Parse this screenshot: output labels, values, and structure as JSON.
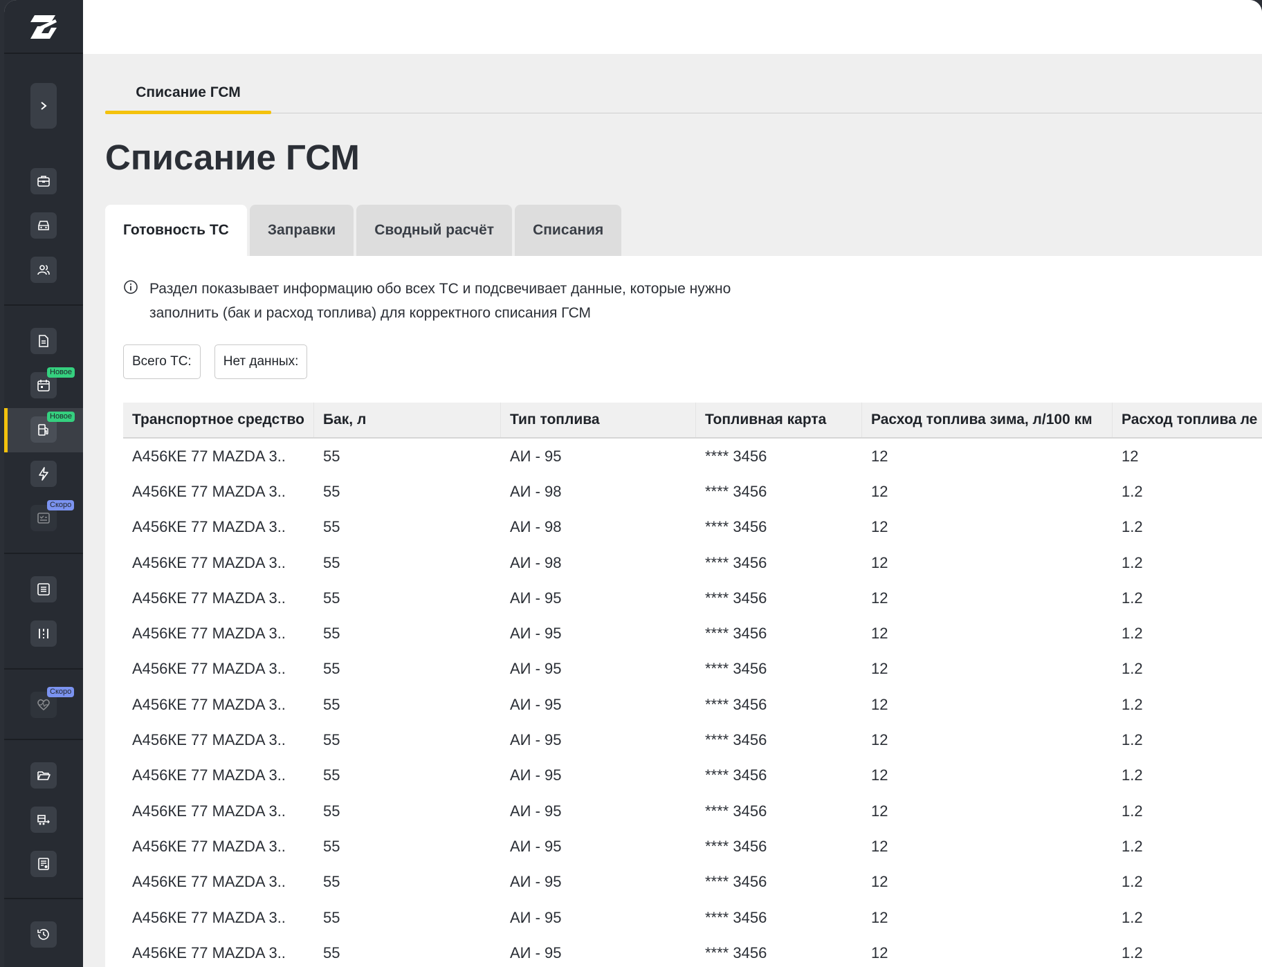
{
  "sidebar": {
    "badges": {
      "new_1": "Новое",
      "new_2": "Новое",
      "soon_1": "Скоро",
      "soon_2": "Скоро"
    }
  },
  "breadcrumb": {
    "tab_label": "Списание ГСМ"
  },
  "page": {
    "title": "Списание ГСМ"
  },
  "tabs": [
    {
      "label": "Готовность ТС",
      "active": true
    },
    {
      "label": "Заправки",
      "active": false
    },
    {
      "label": "Сводный расчёт",
      "active": false
    },
    {
      "label": "Списания",
      "active": false
    }
  ],
  "info": {
    "line1": "Раздел показывает информацию обо всех ТС и подсвечивает данные, которые нужно",
    "line2": "заполнить (бак и расход топлива) для корректного списания ГСМ"
  },
  "chips": {
    "total": "Всего ТС:",
    "no_data": "Нет данных:"
  },
  "colors": {
    "accent": "#f4c20d",
    "sidebar_bg": "#272b32",
    "badge_new": "#35d07f",
    "badge_soon": "#7b93f0"
  },
  "table": {
    "headers": [
      "Транспортное средство",
      "Бак, л",
      "Тип топлива",
      "Топливная карта",
      "Расход топлива зима, л/100 км",
      "Расход топлива ле"
    ],
    "rows": [
      [
        "А456КЕ 77 MAZDA 3..",
        "55",
        "АИ - 95",
        "**** 3456",
        "12",
        "12"
      ],
      [
        "А456КЕ 77 MAZDA 3..",
        "55",
        "АИ - 98",
        "**** 3456",
        "12",
        "1.2"
      ],
      [
        "А456КЕ 77 MAZDA 3..",
        "55",
        "АИ - 98",
        "**** 3456",
        "12",
        "1.2"
      ],
      [
        "А456КЕ 77 MAZDA 3..",
        "55",
        "АИ - 98",
        "**** 3456",
        "12",
        "1.2"
      ],
      [
        "А456КЕ 77 MAZDA 3..",
        "55",
        "АИ - 95",
        "**** 3456",
        "12",
        "1.2"
      ],
      [
        "А456КЕ 77 MAZDA 3..",
        "55",
        "АИ - 95",
        "**** 3456",
        "12",
        "1.2"
      ],
      [
        "А456КЕ 77 MAZDA 3..",
        "55",
        "АИ - 95",
        "**** 3456",
        "12",
        "1.2"
      ],
      [
        "А456КЕ 77 MAZDA 3..",
        "55",
        "АИ - 95",
        "**** 3456",
        "12",
        "1.2"
      ],
      [
        "А456КЕ 77 MAZDA 3..",
        "55",
        "АИ - 95",
        "**** 3456",
        "12",
        "1.2"
      ],
      [
        "А456КЕ 77 MAZDA 3..",
        "55",
        "АИ - 95",
        "**** 3456",
        "12",
        "1.2"
      ],
      [
        "А456КЕ 77 MAZDA 3..",
        "55",
        "АИ - 95",
        "**** 3456",
        "12",
        "1.2"
      ],
      [
        "А456КЕ 77 MAZDA 3..",
        "55",
        "АИ - 95",
        "**** 3456",
        "12",
        "1.2"
      ],
      [
        "А456КЕ 77 MAZDA 3..",
        "55",
        "АИ - 95",
        "**** 3456",
        "12",
        "1.2"
      ],
      [
        "А456КЕ 77 MAZDA 3..",
        "55",
        "АИ - 95",
        "**** 3456",
        "12",
        "1.2"
      ],
      [
        "А456КЕ 77 MAZDA 3..",
        "55",
        "АИ - 95",
        "**** 3456",
        "12",
        "1.2"
      ]
    ]
  }
}
